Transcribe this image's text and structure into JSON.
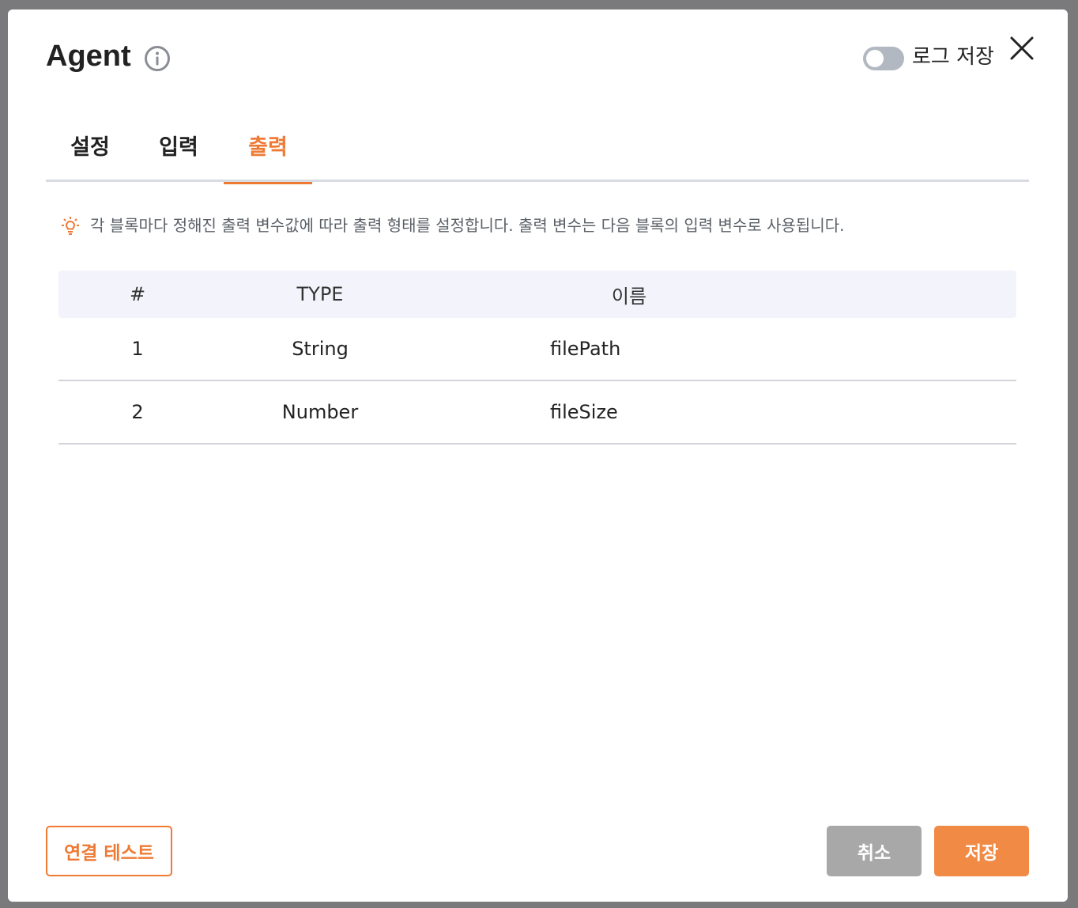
{
  "header": {
    "title": "Agent",
    "log_toggle_label": "로그 저장",
    "log_toggle_on": false
  },
  "tabs": [
    {
      "label": "설정",
      "active": false
    },
    {
      "label": "입력",
      "active": false
    },
    {
      "label": "출력",
      "active": true
    }
  ],
  "notice": "각 블록마다 정해진 출력 변수값에 따라 출력 형태를 설정합니다. 출력 변수는 다음 블록의 입력 변수로 사용됩니다.",
  "table": {
    "headers": {
      "index": "#",
      "type": "TYPE",
      "name": "이름"
    },
    "rows": [
      {
        "index": "1",
        "type": "String",
        "name": "filePath"
      },
      {
        "index": "2",
        "type": "Number",
        "name": "fileSize"
      }
    ]
  },
  "footer": {
    "test_label": "연결 테스트",
    "cancel_label": "취소",
    "save_label": "저장"
  },
  "colors": {
    "accent": "#ee7a34",
    "cancel": "#a8a8a8",
    "header_bg": "#f3f4fb"
  }
}
